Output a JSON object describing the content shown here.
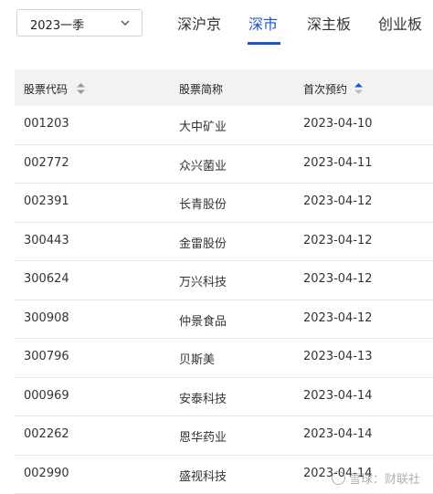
{
  "filter": {
    "period_value": "2023一季"
  },
  "tabs": [
    {
      "label": "深沪京",
      "active": false
    },
    {
      "label": "深市",
      "active": true
    },
    {
      "label": "深主板",
      "active": false
    },
    {
      "label": "创业板",
      "active": false
    }
  ],
  "table": {
    "headers": {
      "code": "股票代码",
      "name": "股票简称",
      "date": "首次预约"
    },
    "rows": [
      {
        "code": "001203",
        "name": "大中矿业",
        "date": "2023-04-10"
      },
      {
        "code": "002772",
        "name": "众兴菌业",
        "date": "2023-04-11"
      },
      {
        "code": "002391",
        "name": "长青股份",
        "date": "2023-04-12"
      },
      {
        "code": "300443",
        "name": "金雷股份",
        "date": "2023-04-12"
      },
      {
        "code": "300624",
        "name": "万兴科技",
        "date": "2023-04-12"
      },
      {
        "code": "300908",
        "name": "仲景食品",
        "date": "2023-04-12"
      },
      {
        "code": "300796",
        "name": "贝斯美",
        "date": "2023-04-13"
      },
      {
        "code": "000969",
        "name": "安泰科技",
        "date": "2023-04-14"
      },
      {
        "code": "002262",
        "name": "恩华药业",
        "date": "2023-04-14"
      },
      {
        "code": "002990",
        "name": "盛视科技",
        "date": "2023-04-14"
      }
    ]
  },
  "watermark": {
    "text": "雪球：财联社"
  },
  "colors": {
    "accent": "#1a56c4",
    "header_bg": "#f2f2f2"
  }
}
